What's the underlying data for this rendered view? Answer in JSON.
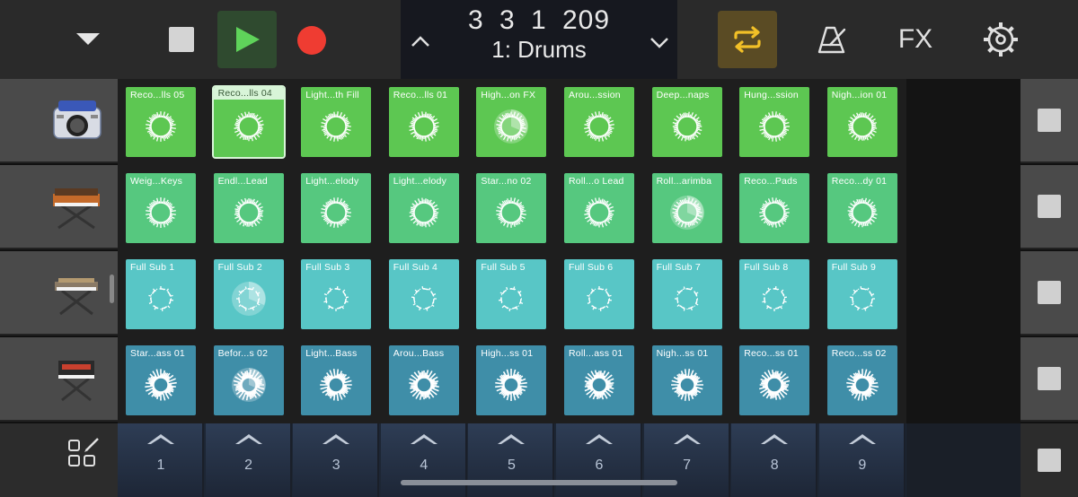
{
  "toolbar": {
    "position": "3   3   1   209",
    "track_name": "1: Drums",
    "fx_label": "FX"
  },
  "tracks": [
    {
      "instrument": "Drums (beat machine)"
    },
    {
      "instrument": "Synth (keyboard on stand)"
    },
    {
      "instrument": "Bass synth (keyboard on stand)"
    },
    {
      "instrument": "Keyboard synth (keyboard on stand)"
    }
  ],
  "rows": [
    {
      "color": "#5dc752",
      "cells": [
        "Reco...lls 05",
        "Reco...lls 04",
        "Light...th Fill",
        "Reco...lls 01",
        "High...on FX",
        "Arou...ssion",
        "Deep...naps",
        "Hung...ssion",
        "Nigh...ion 01"
      ]
    },
    {
      "color": "#56c87f",
      "cells": [
        "Weig...Keys",
        "Endl...Lead",
        "Light...elody",
        "Light...elody",
        "Star...no 02",
        "Roll...o Lead",
        "Roll...arimba",
        "Reco...Pads",
        "Reco...dy 01"
      ]
    },
    {
      "color": "#58c6c6",
      "cells": [
        "Full Sub 1",
        "Full Sub 2",
        "Full Sub 3",
        "Full Sub 4",
        "Full Sub 5",
        "Full Sub 6",
        "Full Sub 7",
        "Full Sub 8",
        "Full Sub 9"
      ]
    },
    {
      "color": "#3f8ea8",
      "cells": [
        "Star...ass 01",
        "Befor...s 02",
        "Light...Bass",
        "Arou...Bass",
        "High...ss 01",
        "Roll...ass 01",
        "Nigh...ss 01",
        "Reco...ss 01",
        "Reco...ss 02"
      ]
    }
  ],
  "selected_cell": {
    "row": 0,
    "col": 1
  },
  "playing_cells": [
    {
      "row": 0,
      "col": 4
    },
    {
      "row": 1,
      "col": 6
    },
    {
      "row": 2,
      "col": 1
    },
    {
      "row": 3,
      "col": 1
    }
  ],
  "scenes": [
    "1",
    "2",
    "3",
    "4",
    "5",
    "6",
    "7",
    "8",
    "9"
  ]
}
